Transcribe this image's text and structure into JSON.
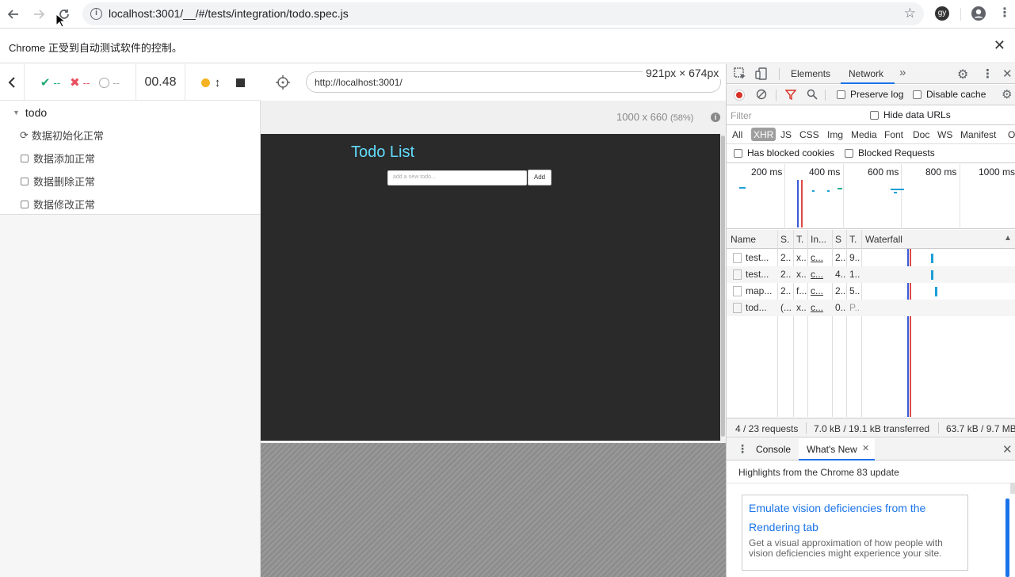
{
  "browser": {
    "url": "localhost:3001/__/#/tests/integration/todo.spec.js",
    "profile_initials": "gy"
  },
  "infobar": {
    "message": "Chrome 正受到自动测试软件的控制。"
  },
  "reporter": {
    "passed": "--",
    "failed": "--",
    "pending": "--",
    "duration": "00.48",
    "suite": "todo",
    "tests": [
      {
        "label": "数据初始化正常",
        "state": "running"
      },
      {
        "label": "数据添加正常",
        "state": "pending"
      },
      {
        "label": "数据删除正常",
        "state": "pending"
      },
      {
        "label": "数据修改正常",
        "state": "pending"
      }
    ]
  },
  "aut": {
    "url": "http://localhost:3001/",
    "viewport_dim": "921px × 674px",
    "size": "1000 x 660",
    "scale": "(58%)",
    "app": {
      "title": "Todo List",
      "input_placeholder": "add a new todo...",
      "add_label": "Add"
    }
  },
  "devtools": {
    "tabs": [
      "Elements",
      "Network"
    ],
    "active_tab": "Network",
    "preserve_log": "Preserve log",
    "disable_cache": "Disable cache",
    "filter_placeholder": "Filter",
    "hide_data_urls": "Hide data URLs",
    "types": [
      "All",
      "XHR",
      "JS",
      "CSS",
      "Img",
      "Media",
      "Font",
      "Doc",
      "WS",
      "Manifest",
      "Ot"
    ],
    "active_type": "XHR",
    "has_blocked_cookies": "Has blocked cookies",
    "blocked_requests": "Blocked Requests",
    "timeline_ticks": [
      "200 ms",
      "400 ms",
      "600 ms",
      "800 ms",
      "1000 ms"
    ],
    "columns": [
      "Name",
      "S.",
      "T.",
      "In...",
      "S",
      "T.",
      "Waterfall"
    ],
    "requests": [
      {
        "name": "test...",
        "status": "2...",
        "type": "x...",
        "initiator": "c...",
        "size": "2...",
        "time": "9..."
      },
      {
        "name": "test...",
        "status": "2...",
        "type": "x...",
        "initiator": "c...",
        "size": "4...",
        "time": "1..."
      },
      {
        "name": "map...",
        "status": "2...",
        "type": "f...",
        "initiator": "c...",
        "size": "2...",
        "time": "5..."
      },
      {
        "name": "tod...",
        "status": "(...",
        "type": "x...",
        "initiator": "c...",
        "size": "0...",
        "time": "P..."
      }
    ],
    "status_requests": "4 / 23 requests",
    "status_transferred": "7.0 kB / 19.1 kB transferred",
    "status_resources": "63.7 kB / 9.7 MB",
    "drawer_tabs": [
      "Console",
      "What's New"
    ],
    "drawer_active": "What's New",
    "whats_new_heading": "Highlights from the Chrome 83 update",
    "card_title": "Emulate vision deficiencies from the Rendering tab",
    "card_desc": "Get a visual approximation of how people with vision deficiencies might experience your site."
  }
}
